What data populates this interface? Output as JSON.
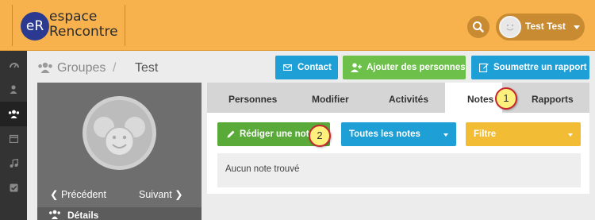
{
  "header": {
    "logo_mark": "eR",
    "logo_line1": "espace",
    "logo_line2": "Rencontre",
    "user_name": "Test Test"
  },
  "sidebar": {
    "items": [
      {
        "icon": "dashboard-icon"
      },
      {
        "icon": "user-icon"
      },
      {
        "icon": "users-icon",
        "active": true
      },
      {
        "icon": "calendar-icon"
      },
      {
        "icon": "music-icon"
      },
      {
        "icon": "checkbox-icon"
      }
    ]
  },
  "breadcrumb": {
    "section": "Groupes",
    "separator": "/",
    "current": "Test"
  },
  "actions": {
    "contact": "Contact",
    "add_people": "Ajouter des personnes",
    "submit_report": "Soumettre un rapport"
  },
  "group_card": {
    "prev": "Précédent",
    "next": "Suivant",
    "details": "Détails"
  },
  "tabs": [
    {
      "label": "Personnes"
    },
    {
      "label": "Modifier"
    },
    {
      "label": "Activités"
    },
    {
      "label": "Notes",
      "active": true
    },
    {
      "label": "Rapports"
    }
  ],
  "notes": {
    "write_button": "Rédiger une note",
    "all_notes": "Toutes les notes",
    "filter": "Filtre",
    "empty_message": "Aucun note trouvé"
  },
  "callouts": {
    "one": "1",
    "two": "2"
  },
  "colors": {
    "header_bg": "#f7b24d",
    "primary_blue": "#1e9fd6",
    "green": "#6dc04a",
    "yellow": "#f2bd34",
    "sidebar_bg": "#333333"
  }
}
